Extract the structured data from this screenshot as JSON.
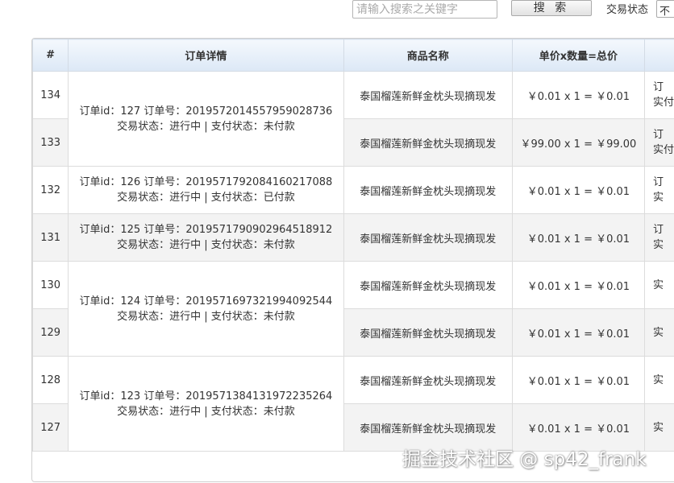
{
  "search": {
    "placeholder": "请输入搜索之关键字",
    "button_label": "搜 索"
  },
  "status_filter": {
    "label": "交易状态",
    "selected": "不"
  },
  "table": {
    "columns": [
      "#",
      "订单详情",
      "商品名称",
      "单价x数量=总价",
      ""
    ],
    "rows": [
      {
        "id": "134",
        "product": "泰国榴莲新鲜金枕头现摘现发",
        "price": "￥0.01 x 1 = ￥0.01",
        "extra_1": "订",
        "extra_2": "实付"
      },
      {
        "id": "133",
        "product": "泰国榴莲新鲜金枕头现摘现发",
        "price": "￥99.00 x 1 = ￥99.00",
        "extra_1": "订",
        "extra_2": "实付"
      },
      {
        "id": "132",
        "product": "泰国榴莲新鲜金枕头现摘现发",
        "price": "￥0.01 x 1 = ￥0.01",
        "extra_1": "订",
        "extra_2": "实"
      },
      {
        "id": "131",
        "product": "泰国榴莲新鲜金枕头现摘现发",
        "price": "￥0.01 x 1 = ￥0.01",
        "extra_1": "订",
        "extra_2": "实"
      },
      {
        "id": "130",
        "product": "泰国榴莲新鲜金枕头现摘现发",
        "price": "￥0.01 x 1 = ￥0.01",
        "extra_1": "",
        "extra_2": "实"
      },
      {
        "id": "129",
        "product": "泰国榴莲新鲜金枕头现摘现发",
        "price": "￥0.01 x 1 = ￥0.01",
        "extra_1": "",
        "extra_2": "实"
      },
      {
        "id": "128",
        "product": "泰国榴莲新鲜金枕头现摘现发",
        "price": "￥0.01 x 1 = ￥0.01",
        "extra_1": "",
        "extra_2": "实"
      },
      {
        "id": "127",
        "product": "泰国榴莲新鲜金枕头现摘现发",
        "price": "￥0.01 x 1 = ￥0.01",
        "extra_1": "",
        "extra_2": "实"
      }
    ],
    "orders": [
      {
        "line1": "订单id：127 订单号：2019572014557959028736",
        "line2": "交易状态：进行中 | 支付状态：未付款"
      },
      {
        "line1": "订单id：126 订单号：2019571792084160217088",
        "line2": "交易状态：进行中 | 支付状态：已付款"
      },
      {
        "line1": "订单id：125 订单号：2019571790902964518912",
        "line2": "交易状态：进行中 | 支付状态：未付款"
      },
      {
        "line1": "订单id：124 订单号：2019571697321994092544",
        "line2": "交易状态：进行中 | 支付状态：未付款"
      },
      {
        "line1": "订单id：123 订单号：2019571384131972235264",
        "line2": "交易状态：进行中 | 支付状态：未付款"
      }
    ]
  },
  "watermark": "掘金技术社区 @ sp42_frank"
}
